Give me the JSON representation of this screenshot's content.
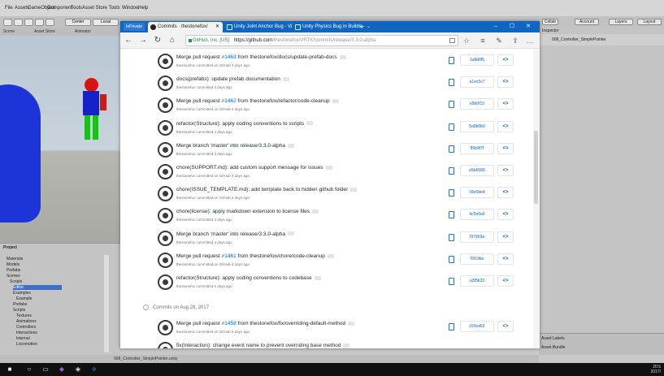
{
  "unity": {
    "menu": [
      "File",
      "Assets",
      "GameObject",
      "Component",
      "Tools",
      "Asset Store Tools",
      "Window",
      "Help"
    ],
    "toolbar": {
      "center": "Center",
      "local": "Local",
      "collab": "Collab",
      "account": "Account",
      "layers": "Layers",
      "layout": "Layout"
    },
    "view_tabs": [
      "Scene",
      "Asset Store",
      "Animator"
    ],
    "panel_tabs": {
      "hierarchy": "Hierarchy",
      "project": "Project",
      "inspector": "Inspector"
    },
    "hierarchy_items": [
      "Materials",
      "Models",
      "Prefabs",
      "Scenes",
      "Scripts",
      "Editor",
      "Examples",
      "Example",
      "Prefabs",
      "Scripts",
      "Textures",
      "Animations",
      "Controllers",
      "Interactions",
      "Internal",
      "Locomotion",
      "Pointers",
      "Presence",
      "UI",
      "Utilities",
      "Controller ThirdPersonSettings"
    ],
    "inspector_object": "008_Controller_SimplePointer",
    "bottom_tabs": [
      "Asset Labels",
      "Asset Bundle"
    ],
    "bottom_status": "008_Controller_SimplePointer.unity"
  },
  "browser": {
    "tab_badge": "InPrivate",
    "tabs": [
      {
        "label": "Commits · thestonefox/",
        "active": true
      },
      {
        "label": "Unity Joint Anchor Bug - Vi",
        "active": false
      },
      {
        "label": "Unity Physics Bug in Builds -",
        "active": false
      }
    ],
    "new_tab": "+",
    "tab_menu": "⌄",
    "window_controls": {
      "minimize": "–",
      "maximize": "☐",
      "close": "✕"
    },
    "nav": {
      "back": "←",
      "forward": "→",
      "refresh": "↻",
      "home": "⌂"
    },
    "address": {
      "org": "GitHub, Inc. [US]",
      "host": "https://github.com",
      "path": "/thestonefox/VRTK/commits/release/3.3.0-alpha"
    },
    "icons": {
      "favorite": "☆",
      "hub": "≡",
      "note": "✎",
      "share": "⇪",
      "more": "…"
    }
  },
  "commits_group_1": [
    {
      "title_prefix": "Merge pull request ",
      "pr": "#1463",
      "title_suffix": " from thestonefox/docs/update-prefab-docs",
      "meta": "thestonefox committed on GitHub 4 days ago",
      "sha": "1a8d0f5"
    },
    {
      "title_prefix": "docs(prefabs): update prefab documentation",
      "pr": "",
      "title_suffix": "",
      "meta": "thestonefox committed 4 days ago",
      "sha": "a1ec5c7"
    },
    {
      "title_prefix": "Merge pull request ",
      "pr": "#1462",
      "title_suffix": " from thestonefox/refactor/code-cleanup",
      "meta": "thestonefox committed on GitHub 4 days ago",
      "sha": "e9b0f15"
    },
    {
      "title_prefix": "refactor(Structure): apply coding conventions to scripts",
      "pr": "",
      "title_suffix": "",
      "meta": "thestonefox committed 4 days ago",
      "sha": "5a8b0b0"
    },
    {
      "title_prefix": "Merge branch 'master' into release/3.3.0-alpha",
      "pr": "",
      "title_suffix": "",
      "meta": "thestonefox committed 4 days ago",
      "sha": "89b9f7f"
    },
    {
      "title_prefix": "chore(SUPPORT.md): add custom support message for issues",
      "pr": "",
      "title_suffix": "",
      "meta": "thestonefox committed on GitHub 4 days ago",
      "sha": "e5b6589"
    },
    {
      "title_prefix": "chore(ISSUE_TEMPLATE.md): add template back to hidden github folder",
      "pr": "",
      "title_suffix": "",
      "meta": "thestonefox committed on GitHub 4 days ago",
      "sha": "c8e5de4"
    },
    {
      "title_prefix": "chore(license): apply markdown extension to license files",
      "pr": "",
      "title_suffix": "",
      "meta": "thestonefox committed 4 days ago",
      "sha": "4c5e0a0"
    },
    {
      "title_prefix": "Merge branch 'master' into release/3.3.0-alpha",
      "pr": "",
      "title_suffix": "",
      "meta": "thestonefox committed 4 days ago",
      "sha": "f37969a"
    },
    {
      "title_prefix": "Merge pull request ",
      "pr": "#1461",
      "title_suffix": " from thestonefox/chore/code-cleanup",
      "meta": "thestonefox committed on GitHub 4 days ago",
      "sha": "f3f19be"
    },
    {
      "title_prefix": "refactor(Structure): apply coding conventions to codebase",
      "pr": "",
      "title_suffix": "",
      "meta": "thestonefox committed 5 days ago",
      "sha": "a3f5b33"
    }
  ],
  "date_header_2": "Commits on Aug 28, 2017",
  "commits_group_2": [
    {
      "title_prefix": "Merge pull request ",
      "pr": "#1458",
      "title_suffix": " from thestonefox/fix/overriding-default-method",
      "meta": "thestonefox committed on GitHub 5 days ago",
      "sha": "c59cd52"
    },
    {
      "title_prefix": "fix(Interaction): change event name to prevent overriding base method",
      "pr": "",
      "title_suffix": "",
      "meta": "thestonefox committed 5 days ago",
      "sha": ""
    }
  ],
  "commit_browse_label": "<>",
  "taskbar": {
    "clock_time": "20:5",
    "clock_date": "2017/"
  },
  "colors": {
    "tabstrip": "#0f66c0",
    "link": "#0366d6",
    "secure": "#1a9e3a",
    "unity_bg": "#c4c4c4"
  }
}
